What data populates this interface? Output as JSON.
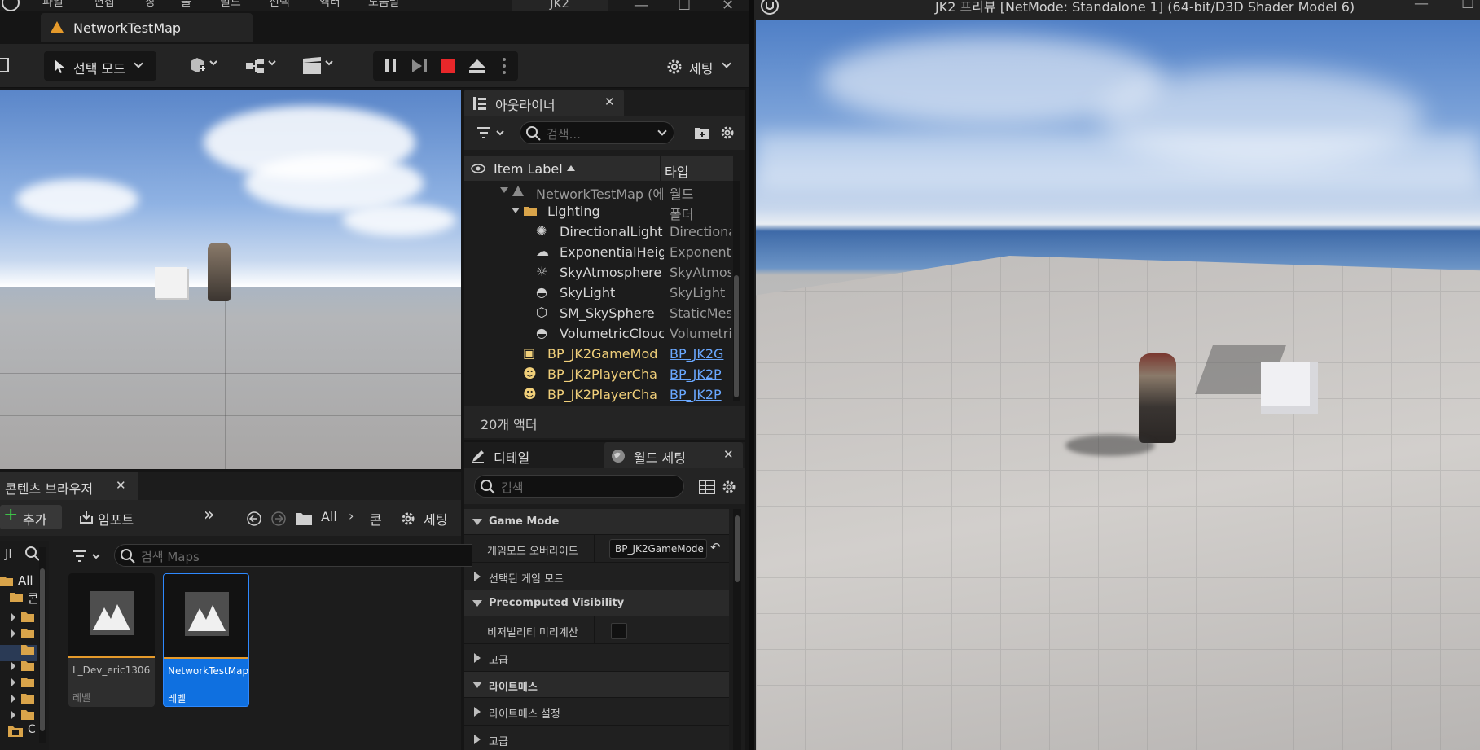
{
  "editor": {
    "menu": [
      "파일",
      "편집",
      "창",
      "툴",
      "빌드",
      "선택",
      "액터",
      "도움말"
    ],
    "project_name": "JK2",
    "map_tab": "NetworkTestMap",
    "toolbar": {
      "select_mode": "선택 모드",
      "settings": "세팅"
    }
  },
  "outliner": {
    "tab_label": "아웃라이너",
    "search_placeholder": "검색...",
    "col_label": "Item Label",
    "col_type": "타입",
    "rows": [
      {
        "label": "NetworkTestMap (에",
        "type": "월드"
      },
      {
        "label": "Lighting",
        "type": "폴더"
      },
      {
        "label": "DirectionalLight",
        "type": "Directiona"
      },
      {
        "label": "ExponentialHeig",
        "type": "Exponent"
      },
      {
        "label": "SkyAtmosphere",
        "type": "SkyAtmos"
      },
      {
        "label": "SkyLight",
        "type": "SkyLight"
      },
      {
        "label": "SM_SkySphere",
        "type": "StaticMes"
      },
      {
        "label": "VolumetricClouc",
        "type": "Volumetri"
      },
      {
        "label": "BP_JK2GameMod",
        "type": "BP_JK2G"
      },
      {
        "label": "BP_JK2PlayerCha",
        "type": "BP_JK2P"
      },
      {
        "label": "BP_JK2PlayerCha",
        "type": "BP_JK2P"
      }
    ],
    "status": "20개 액터"
  },
  "details": {
    "tab_details": "디테일",
    "tab_world": "월드 세팅",
    "search_placeholder": "검색",
    "sections": {
      "game_mode": "Game Mode",
      "gm_override_label": "게임모드 오버라이드",
      "gm_override_value": "BP_JK2GameMode",
      "selected_gm": "선택된 게임 모드",
      "precomputed": "Precomputed Visibility",
      "vis_precompute": "비저빌리티 미리계산",
      "advanced": "고급",
      "lightmass": "라이트매스",
      "lightmass_settings": "라이트매스 설정",
      "advanced2": "고급"
    }
  },
  "content_browser": {
    "tab_label": "콘텐츠 브라우저",
    "add": "추가",
    "import": "임포트",
    "path_all": "All",
    "path_next": "콘",
    "settings": "세팅",
    "search_placeholder": "검색 Maps",
    "tree_root": "All",
    "tree_root_short": "JI",
    "tree_child": "콘",
    "tree_c": "C",
    "assets": [
      {
        "name": "L_Dev_eric1306",
        "type": "레벨"
      },
      {
        "name": "NetworkTestMap",
        "type": "레벨"
      }
    ]
  },
  "preview": {
    "title": "JK2 프리뷰 [NetMode: Standalone 1]  (64-bit/D3D Shader Model 6)"
  }
}
